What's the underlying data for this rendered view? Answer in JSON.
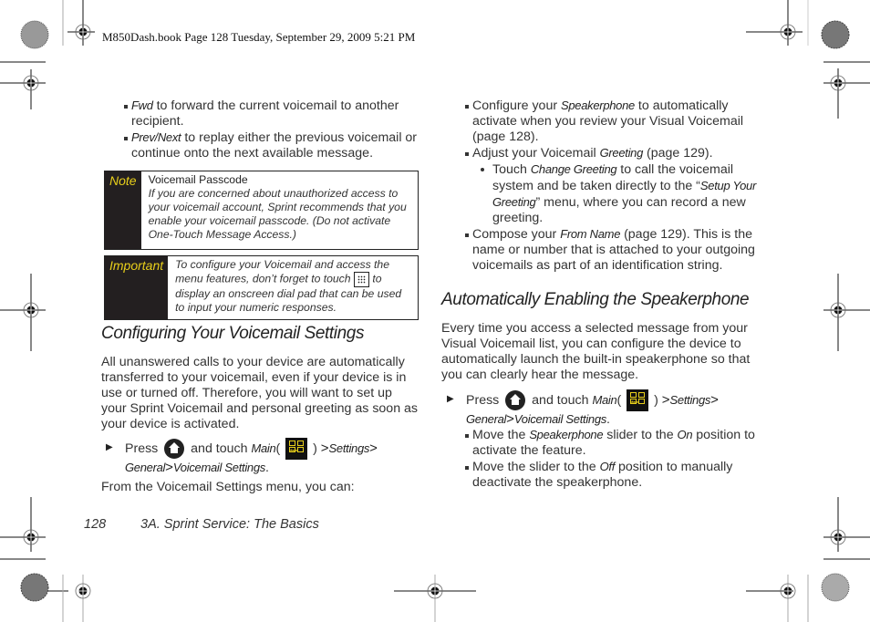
{
  "slug": "M850Dash.book  Page 128  Tuesday, September 29, 2009  5:21 PM",
  "left_column": {
    "bullets": [
      {
        "term": "Fwd",
        "text": " to forward the current voicemail to another recipient."
      },
      {
        "term": "Prev/Next",
        "text": " to replay either the previous voicemail or continue onto the next available message."
      }
    ],
    "note": {
      "label": "Note",
      "title": "Voicemail Passcode",
      "body": "If you are concerned about unauthorized access to your voicemail account, Sprint recommends that you enable your voicemail passcode. (Do not activate One-Touch Message Access.)"
    },
    "important": {
      "label": "Important",
      "body_before": "To configure your Voicemail and access the menu features, don’t forget to touch ",
      "icon": "dialpad-icon",
      "body_after": " to display an onscreen dial pad that can be used to input your numeric responses."
    },
    "heading": "Configuring Your Voicemail Settings",
    "paragraph": "All unanswered calls to your device are automatically transferred to your voicemail, even if your device is in use or turned off. Therefore, you will want to set up your Sprint Voicemail and personal greeting as soon as your device is activated.",
    "step": {
      "press": "Press",
      "and_touch": "and touch",
      "main": "Main",
      "open_paren": "(",
      "close_paren": ")",
      "path": [
        "Settings",
        "General",
        "Voicemail Settings"
      ],
      "separator": ">",
      "end": "."
    },
    "outro": "From the Voicemail Settings menu, you can:"
  },
  "right_column": {
    "bullets": [
      {
        "before": "Configure your ",
        "term": "Speakerphone",
        "after": " to automatically activate when you review your Visual Voicemail (page 128)."
      },
      {
        "before": "Adjust your Voicemail ",
        "term": "Greeting",
        "after": " (page 129)."
      }
    ],
    "sub_bullet": {
      "before": "Touch ",
      "term": "Change Greeting",
      "middle": " to call the voicemail system and be taken directly to the “",
      "term2": "Setup Your Greeting",
      "after": "” menu, where you can record a new greeting."
    },
    "bullet3": {
      "before": "Compose your ",
      "term": "From Name",
      "after": " (page 129). This is the name or number that is attached to your outgoing voicemails as part of an identification string."
    },
    "heading": "Automatically Enabling the Speakerphone",
    "paragraph": "Every time you access a selected message from your Visual Voicemail list, you can configure the device to automatically launch the built-in speakerphone so that you can clearly hear the message.",
    "step": {
      "press": "Press",
      "and_touch": "and touch",
      "main": "Main",
      "open_paren": "(",
      "close_paren": ")",
      "path": [
        "Settings",
        "General",
        "Voicemail Settings"
      ],
      "separator": ">",
      "end": "."
    },
    "sub_items": [
      {
        "before": "Move the ",
        "term": "Speakerphone",
        "middle": " slider to the ",
        "term2": "On",
        "after": " position to activate the feature."
      },
      {
        "before": "Move the slider to the ",
        "term": "Off",
        "after": " position to manually deactivate the speakerphone."
      }
    ]
  },
  "footer": {
    "page_number": "128",
    "section": "3A. Sprint Service: The Basics"
  },
  "icons": {
    "home": "home-icon",
    "main": "main-menu-icon",
    "main_icon_caption": "Main",
    "bullet_arrow": "▶"
  },
  "colors": {
    "label_bg": "#231f20",
    "label_text": "#e8cf1a",
    "body_text": "#333333"
  }
}
